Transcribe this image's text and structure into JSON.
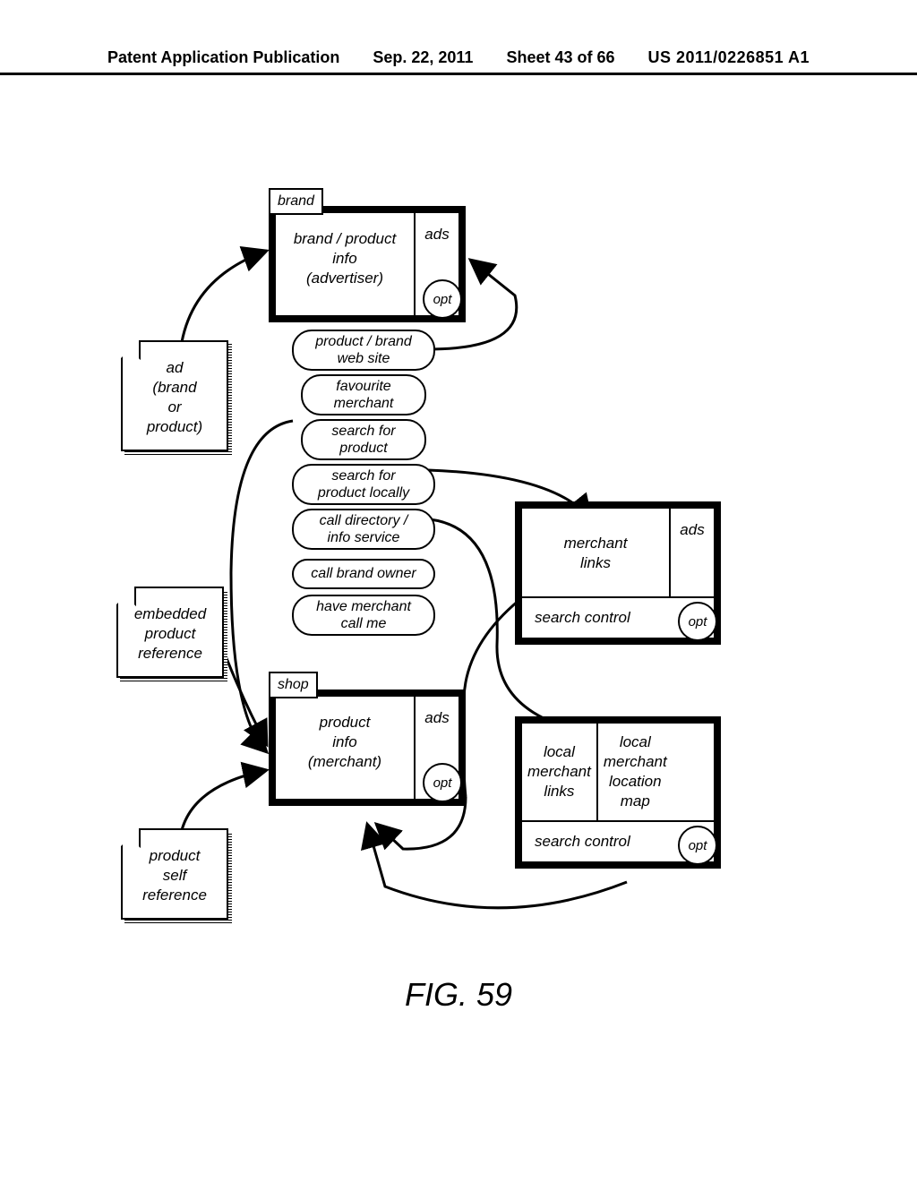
{
  "header": {
    "left": "Patent Application Publication",
    "date": "Sep. 22, 2011",
    "sheet": "Sheet 43 of 66",
    "pub_id": "US 2011/0226851 A1"
  },
  "docs": {
    "ad": "ad\n(brand\nor\nproduct)",
    "embedded": "embedded\nproduct\nreference",
    "self": "product\nself\nreference"
  },
  "screens": {
    "brand": {
      "tag": "brand",
      "main": "brand / product\ninfo\n(advertiser)",
      "ads": "ads",
      "opt": "opt"
    },
    "shop": {
      "tag": "shop",
      "main": "product\ninfo\n(merchant)",
      "ads": "ads",
      "opt": "opt"
    },
    "merchant_links": {
      "main": "merchant\nlinks",
      "ads": "ads",
      "bottom": "search control",
      "opt": "opt"
    },
    "local_merchant": {
      "left": "local\nmerchant\nlinks",
      "right": "local\nmerchant\nlocation\nmap",
      "bottom": "search control",
      "opt": "opt"
    }
  },
  "ovals": {
    "website": "product / brand\nweb site",
    "fav": "favourite\nmerchant",
    "search_product": "search for\nproduct",
    "search_local": "search for\nproduct locally",
    "call_dir": "call directory /\ninfo service",
    "call_owner": "call brand owner",
    "have_call": "have merchant\ncall me"
  },
  "caption": "FIG. 59"
}
